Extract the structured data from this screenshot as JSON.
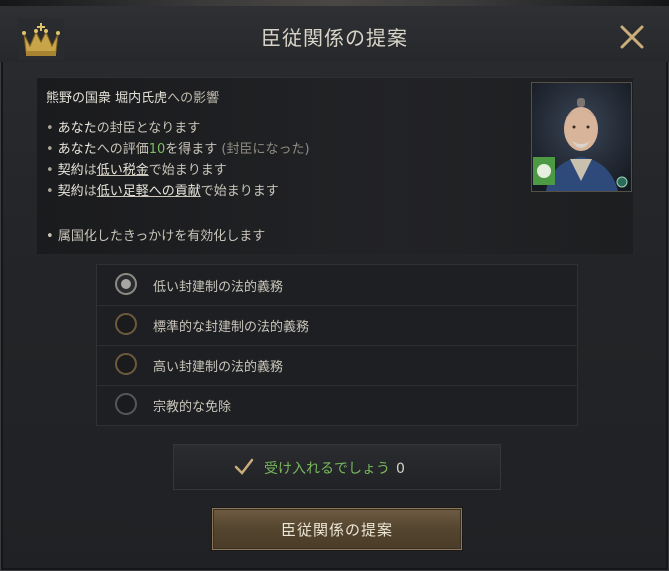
{
  "dialog": {
    "title": "臣従関係の提案",
    "close_icon": "close-icon",
    "crown_icon": "crown-icon"
  },
  "effects": {
    "subject_name": "熊野の国衆 堀内氏虎",
    "subject_suffix": "への影響",
    "lines": [
      {
        "a": "あなた",
        "b": "の封臣となります"
      },
      {
        "a": "あなた",
        "b": "への評価",
        "c": "10",
        "d": "を得ます",
        "e": "(封臣になった)"
      },
      {
        "a": "契約",
        "b": "は",
        "c": "低い税金",
        "d": "で始まります"
      },
      {
        "a": "契約",
        "b": "は",
        "c": "低い足軽への貢献",
        "d": "で始まります"
      }
    ],
    "extra": "属国化したきっかけを有効化します"
  },
  "options": [
    {
      "label": "低い封建制の法的義務",
      "selected": true
    },
    {
      "label": "標準的な封建制の法的義務",
      "selected": false
    },
    {
      "label": "高い封建制の法的義務",
      "selected": false
    },
    {
      "label": "宗教的な免除",
      "selected": false
    }
  ],
  "acceptance": {
    "label": "受け入れるでしょう",
    "value": "0",
    "color": "#79b85c"
  },
  "propose_button": "臣従関係の提案"
}
